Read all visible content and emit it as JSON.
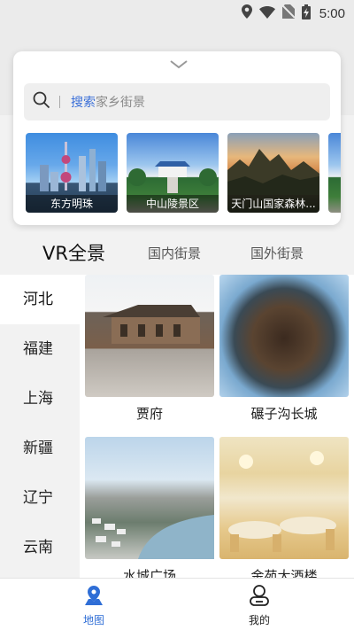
{
  "status_bar": {
    "time": "5:00",
    "icons": [
      "location-icon",
      "wifi-icon",
      "no-sim-icon",
      "battery-charging-icon"
    ]
  },
  "search": {
    "highlight": "搜索",
    "rest": "家乡街景"
  },
  "featured_places": [
    {
      "label": "东方明珠"
    },
    {
      "label": "中山陵景区"
    },
    {
      "label": "天门山国家森林..."
    }
  ],
  "tabs": [
    {
      "label": "VR全景",
      "active": true
    },
    {
      "label": "国内街景",
      "active": false
    },
    {
      "label": "国外街景",
      "active": false
    }
  ],
  "provinces": [
    {
      "label": "河北",
      "active": true
    },
    {
      "label": "福建",
      "active": false
    },
    {
      "label": "上海",
      "active": false
    },
    {
      "label": "新疆",
      "active": false
    },
    {
      "label": "辽宁",
      "active": false
    },
    {
      "label": "云南",
      "active": false
    }
  ],
  "scenes": [
    {
      "label": "贾府"
    },
    {
      "label": "碾子沟长城"
    },
    {
      "label": "水城广场"
    },
    {
      "label": "金苑大酒楼"
    }
  ],
  "bottom_nav": [
    {
      "label": "地图",
      "icon": "map-pin-icon",
      "active": true
    },
    {
      "label": "我的",
      "icon": "profile-icon",
      "active": false
    }
  ],
  "colors": {
    "accent": "#2f6ed6"
  }
}
